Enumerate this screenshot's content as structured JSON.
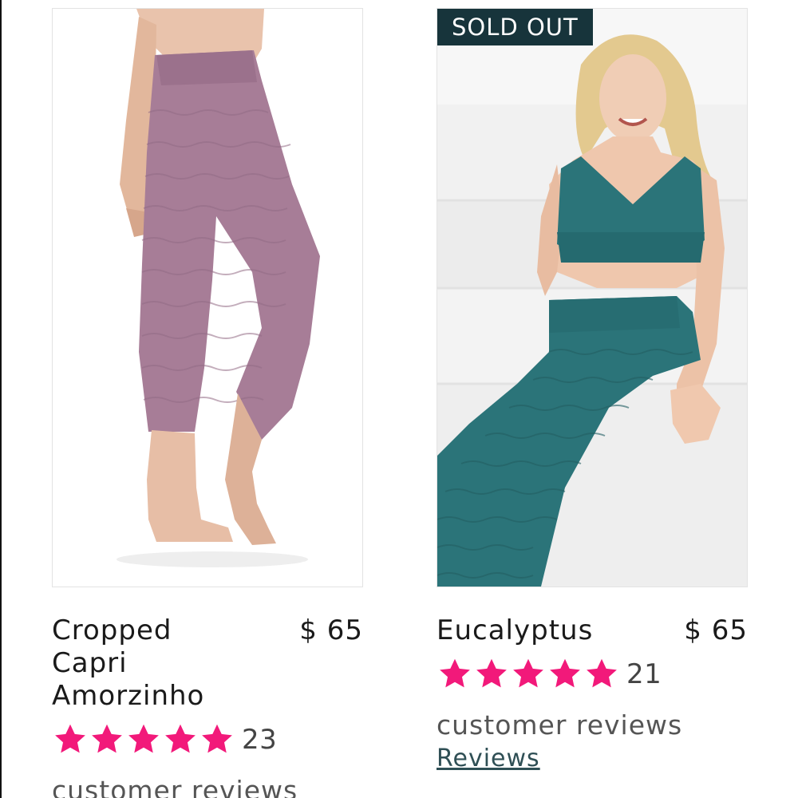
{
  "products": [
    {
      "title_lines": [
        "Cropped",
        "Capri",
        "Amorzinho"
      ],
      "price": "$ 65",
      "rating_icon": "star-icon",
      "rating": 5,
      "review_count": "23",
      "reviews_text": "customer reviews",
      "legging_color": "#a77d97"
    },
    {
      "badge": "SOLD OUT",
      "title_lines": [
        "Eucalyptus"
      ],
      "price": "$ 65",
      "rating_icon": "star-icon",
      "rating": 5,
      "review_count": "21",
      "reviews_text": "customer reviews",
      "reviews_link": "Reviews",
      "outfit_color": "#2b7479"
    }
  ],
  "colors": {
    "star": "#f2197a",
    "badge_bg": "#17343b",
    "link": "#2f4f55"
  }
}
